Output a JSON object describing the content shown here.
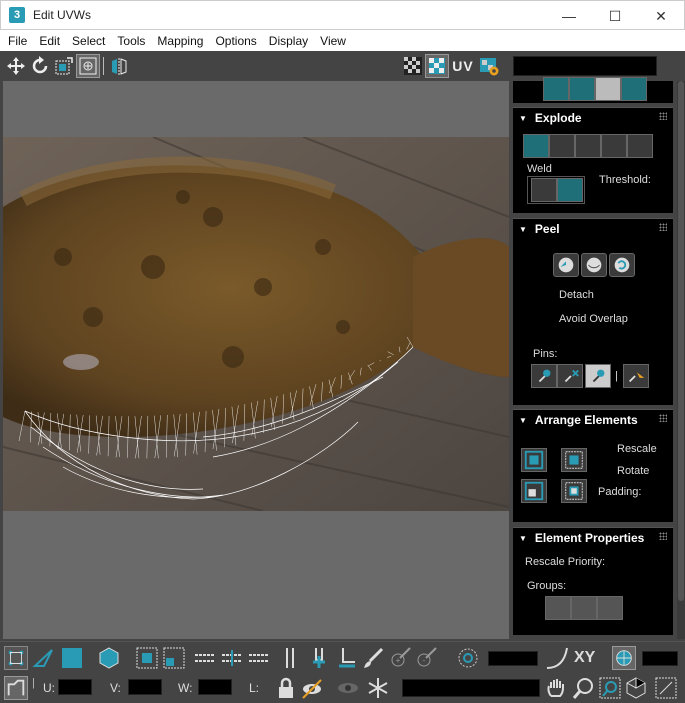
{
  "window": {
    "app_icon_text": "3",
    "title": "Edit UVWs",
    "minimize_glyph": "—",
    "maximize_glyph": "☐",
    "close_glyph": "✕"
  },
  "menu": [
    "File",
    "Edit",
    "Select",
    "Tools",
    "Mapping",
    "Options",
    "Display",
    "View"
  ],
  "toolbar": {
    "uv_label": "UV"
  },
  "panels": {
    "explode": {
      "title": "Explode",
      "weld_label": "Weld",
      "threshold_label": "Threshold:"
    },
    "peel": {
      "title": "Peel",
      "detach_label": "Detach",
      "avoid_overlap_label": "Avoid Overlap",
      "pins_label": "Pins:"
    },
    "arrange": {
      "title": "Arrange Elements",
      "rescale_label": "Rescale",
      "rotate_label": "Rotate",
      "padding_label": "Padding:"
    },
    "element_props": {
      "title": "Element Properties",
      "rescale_priority_label": "Rescale Priority:",
      "groups_label": "Groups:"
    }
  },
  "bottom": {
    "xy_label": "XY",
    "u_label": "U:",
    "v_label": "V:",
    "w_label": "W:",
    "l_label": "L:"
  },
  "colors": {
    "teal": "#2a9bb5",
    "panel_bg": "#000000",
    "ui_bg": "#444444"
  }
}
